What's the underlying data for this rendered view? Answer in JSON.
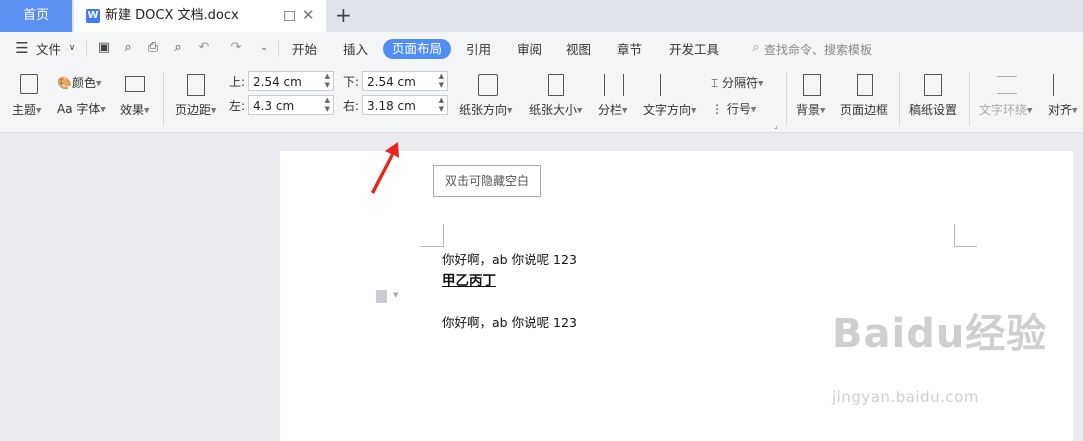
{
  "tabs": {
    "home": "首页",
    "document": "新建 DOCX 文档.docx"
  },
  "menu": {
    "file": "文件",
    "items": [
      "开始",
      "插入",
      "页面布局",
      "引用",
      "审阅",
      "视图",
      "章节",
      "开发工具"
    ],
    "active": "页面布局",
    "search": "查找命令、搜索模板"
  },
  "ribbon": {
    "theme": "主题",
    "color": "颜色",
    "font": "字体",
    "effects": "效果",
    "margins": "页边距",
    "margin_labels": {
      "top": "上:",
      "bottom": "下:",
      "left": "左:",
      "right": "右:"
    },
    "margin_values": {
      "top": "2.54 cm",
      "bottom": "2.54 cm",
      "left": "4.3 cm",
      "right": "3.18 cm"
    },
    "orientation": "纸张方向",
    "size": "纸张大小",
    "columns": "分栏",
    "text_direction": "文字方向",
    "breaks": "分隔符",
    "line_numbers": "行号",
    "background": "背景",
    "page_border": "页面边框",
    "grid_paper": "稿纸设置",
    "text_wrap": "文字环绕",
    "align": "对齐"
  },
  "document": {
    "hide_blank_button": "双击可隐藏空白",
    "line1": "你好啊，ab 你说呢 123",
    "heading": "甲乙丙丁",
    "line3": "你好啊，ab 你说呢 123"
  },
  "watermark": {
    "logo": "Baidu经验",
    "url": "jingyan.baidu.com"
  },
  "colors": {
    "accent": "#4f8df7",
    "home_tab": "#5b8ff2",
    "arrow": "#e8231c"
  },
  "icons": [
    "menu-icon",
    "save-icon",
    "undo-icon",
    "redo-icon",
    "print-icon",
    "preview-icon",
    "search-icon",
    "close-icon",
    "plus-icon"
  ]
}
